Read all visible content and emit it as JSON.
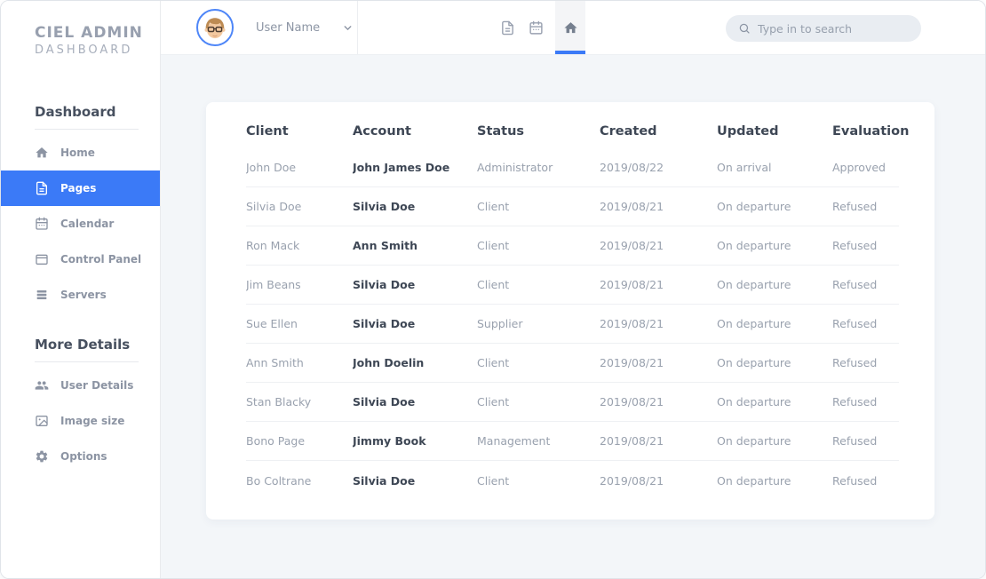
{
  "app": {
    "title_line1": "CIEL ADMIN",
    "title_line2": "DASHBOARD"
  },
  "colors": {
    "accent": "#3b7af7",
    "content_bg": "#f3f6f9",
    "text_dark": "#3e4755",
    "text_light": "#99a1ae"
  },
  "sidebar": {
    "sections": [
      {
        "heading": "Dashboard",
        "items": [
          {
            "label": "Home",
            "icon": "home-icon",
            "active": false
          },
          {
            "label": "Pages",
            "icon": "file-icon",
            "active": true
          },
          {
            "label": "Calendar",
            "icon": "calendar-icon",
            "active": false
          },
          {
            "label": "Control Panel",
            "icon": "window-icon",
            "active": false
          },
          {
            "label": "Servers",
            "icon": "server-icon",
            "active": false
          }
        ]
      },
      {
        "heading": "More Details",
        "items": [
          {
            "label": "User Details",
            "icon": "users-icon",
            "active": false
          },
          {
            "label": "Image size",
            "icon": "image-icon",
            "active": false
          },
          {
            "label": "Options",
            "icon": "gear-icon",
            "active": false
          }
        ]
      }
    ]
  },
  "topbar": {
    "user_name": "User Name",
    "shortcut_icons": [
      "file-icon",
      "calendar-icon"
    ],
    "active_tab_icon": "home-icon",
    "search": {
      "placeholder": "Type in to search",
      "icon": "search-icon"
    }
  },
  "table": {
    "columns": [
      "Client",
      "Account",
      "Status",
      "Created",
      "Updated",
      "Evaluation"
    ],
    "rows": [
      [
        "John Doe",
        "John James Doe",
        "Administrator",
        "2019/08/22",
        "On arrival",
        "Approved"
      ],
      [
        "Silvia Doe",
        "Silvia Doe",
        "Client",
        "2019/08/21",
        "On departure",
        "Refused"
      ],
      [
        "Ron Mack",
        "Ann Smith",
        "Client",
        "2019/08/21",
        "On departure",
        "Refused"
      ],
      [
        "Jim Beans",
        "Silvia Doe",
        "Client",
        "2019/08/21",
        "On departure",
        "Refused"
      ],
      [
        "Sue Ellen",
        "Silvia Doe",
        "Supplier",
        "2019/08/21",
        "On departure",
        "Refused"
      ],
      [
        "Ann Smith",
        "John Doelin",
        "Client",
        "2019/08/21",
        "On departure",
        "Refused"
      ],
      [
        "Stan Blacky",
        "Silvia Doe",
        "Client",
        "2019/08/21",
        "On departure",
        "Refused"
      ],
      [
        "Bono Page",
        "Jimmy Book",
        "Management",
        "2019/08/21",
        "On departure",
        "Refused"
      ],
      [
        "Bo Coltrane",
        "Silvia Doe",
        "Client",
        "2019/08/21",
        "On departure",
        "Refused"
      ]
    ]
  }
}
